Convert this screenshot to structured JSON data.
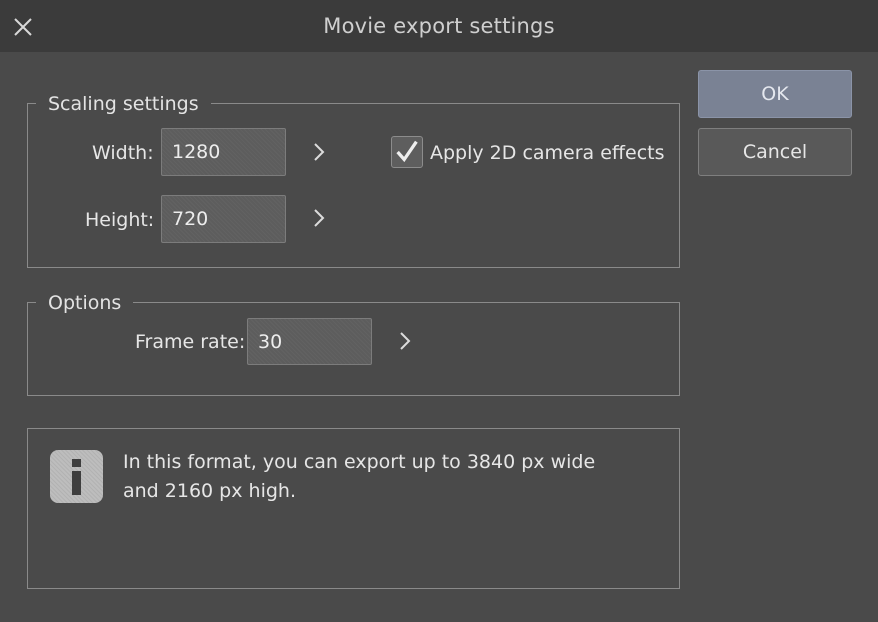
{
  "window": {
    "title": "Movie export settings",
    "close_icon": "close-icon"
  },
  "scaling": {
    "legend": "Scaling settings",
    "width_label": "Width:",
    "width_value": "1280",
    "height_label": "Height:",
    "height_value": "720",
    "camera_effects_label": "Apply 2D camera effects",
    "camera_effects_checked": true
  },
  "options": {
    "legend": "Options",
    "frame_rate_label": "Frame rate:",
    "frame_rate_value": "30"
  },
  "info": {
    "icon": "info-icon",
    "line1": "In this format, you can export up to 3840 px wide",
    "line2": "and 2160 px high."
  },
  "buttons": {
    "ok": "OK",
    "cancel": "Cancel"
  },
  "colors": {
    "background": "#4a4a4a",
    "titlebar": "#3b3b3b",
    "ok_button": "#7a8294"
  }
}
